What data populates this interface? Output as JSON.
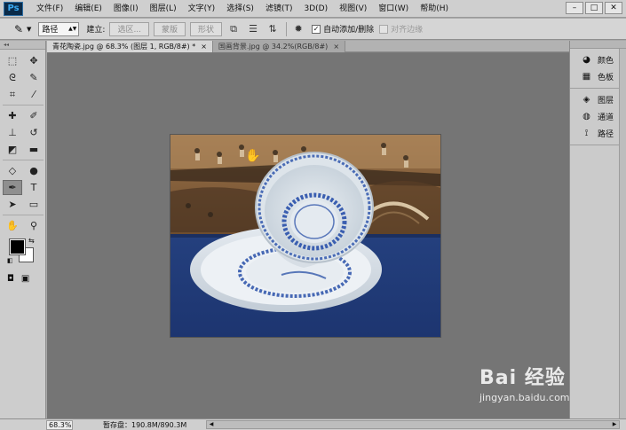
{
  "app": {
    "logo": "Ps"
  },
  "menu": [
    "文件(F)",
    "编辑(E)",
    "图像(I)",
    "图层(L)",
    "文字(Y)",
    "选择(S)",
    "滤镜(T)",
    "3D(D)",
    "视图(V)",
    "窗口(W)",
    "帮助(H)"
  ],
  "window_controls": {
    "minimize": "–",
    "maximize": "□",
    "close": "✕"
  },
  "options": {
    "tool_glyph": "✎",
    "mode_value": "路径",
    "build_label": "建立:",
    "btn_selection": "选区...",
    "btn_mask": "蒙版",
    "btn_shape": "形状",
    "auto_add_label": "自动添加/删除",
    "auto_add_checked": true,
    "align_edges_label": "对齐边缘",
    "align_edges_checked": false
  },
  "tabs": [
    {
      "label": "青花陶瓷.jpg @ 68.3% (图层 1, RGB/8#) *",
      "close": "×",
      "active": true
    },
    {
      "label": "国画背景.jpg @ 34.2%(RGB/8#)",
      "close": "×",
      "active": false
    }
  ],
  "tools": [
    {
      "name": "marquee-tool-icon",
      "glyph": "⬚"
    },
    {
      "name": "move-tool-icon",
      "glyph": "✥"
    },
    {
      "name": "lasso-tool-icon",
      "glyph": "ᘓ"
    },
    {
      "name": "quick-select-tool-icon",
      "glyph": "✎"
    },
    {
      "name": "crop-tool-icon",
      "glyph": "⌗"
    },
    {
      "name": "eyedropper-tool-icon",
      "glyph": "⁄"
    },
    {
      "name": "healing-brush-tool-icon",
      "glyph": "✚"
    },
    {
      "name": "brush-tool-icon",
      "glyph": "✐"
    },
    {
      "name": "clone-stamp-tool-icon",
      "glyph": "⊥"
    },
    {
      "name": "history-brush-tool-icon",
      "glyph": "↺"
    },
    {
      "name": "eraser-tool-icon",
      "glyph": "◩"
    },
    {
      "name": "gradient-tool-icon",
      "glyph": "▬"
    },
    {
      "name": "blur-tool-icon",
      "glyph": "◇"
    },
    {
      "name": "dodge-tool-icon",
      "glyph": "●"
    },
    {
      "name": "pen-tool-icon",
      "glyph": "✒"
    },
    {
      "name": "type-tool-icon",
      "glyph": "T"
    },
    {
      "name": "path-select-tool-icon",
      "glyph": "➤"
    },
    {
      "name": "rectangle-tool-icon",
      "glyph": "▭"
    },
    {
      "name": "hand-tool-icon",
      "glyph": "✋"
    },
    {
      "name": "zoom-tool-icon",
      "glyph": "⚲"
    }
  ],
  "active_tool": "pen-tool-icon",
  "right_panels": {
    "group1": [
      {
        "label": "颜色",
        "glyph": "◕"
      },
      {
        "label": "色板",
        "glyph": "▦"
      }
    ],
    "group2": [
      {
        "label": "图层",
        "glyph": "◈"
      },
      {
        "label": "通道",
        "glyph": "◍"
      },
      {
        "label": "路径",
        "glyph": "⟟"
      }
    ]
  },
  "status": {
    "zoom": "68.3%",
    "doc_info": "暂存盘：190.8M/890.3M"
  },
  "watermark": {
    "brand": "Bai 经验",
    "url": "jingyan.baidu.com"
  }
}
